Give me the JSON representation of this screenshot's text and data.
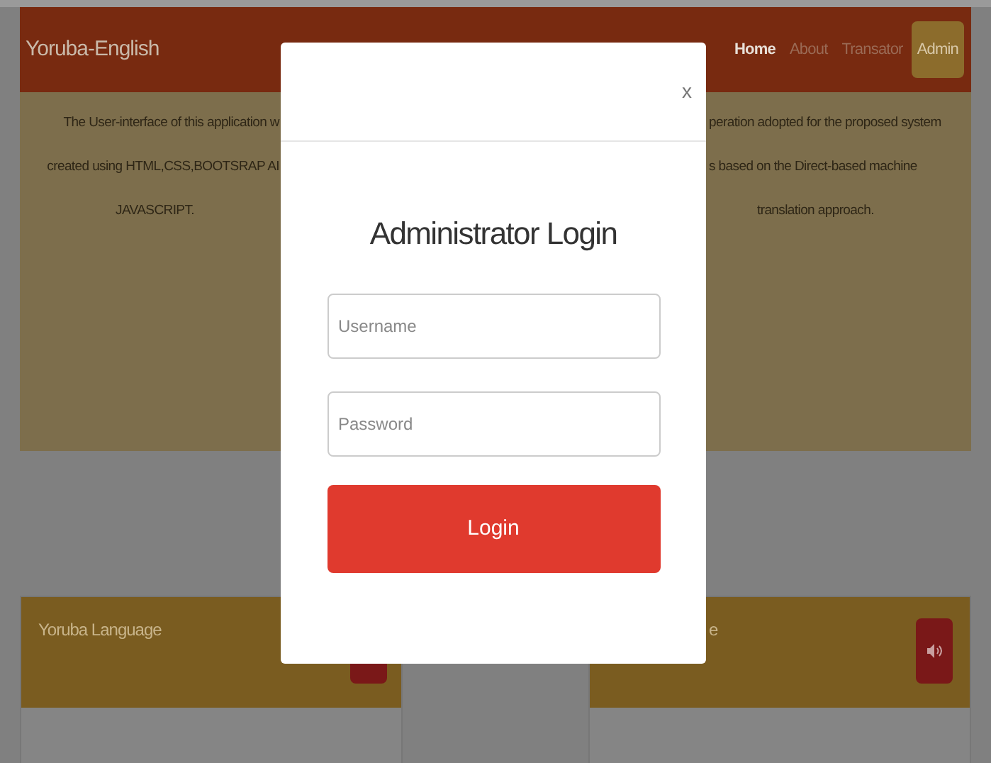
{
  "navbar": {
    "brand": "Yoruba-English",
    "links": [
      {
        "label": "Home",
        "selected": false,
        "current": true
      },
      {
        "label": "About",
        "selected": false,
        "current": false
      },
      {
        "label": "Transator",
        "selected": false,
        "current": false
      },
      {
        "label": "Admin",
        "selected": true,
        "current": false
      }
    ]
  },
  "intro": {
    "left_lines": [
      "The User-interface of this application w",
      "created using HTML,CSS,BOOTSRAP AI",
      "JAVASCRIPT."
    ],
    "right_lines": [
      "peration adopted for the proposed system",
      "s based on the Direct-based machine",
      "translation approach."
    ]
  },
  "cards": [
    {
      "title": "Yoruba Language"
    },
    {
      "title": "e"
    }
  ],
  "modal": {
    "close": "x",
    "title": "Administrator Login",
    "fields": [
      {
        "placeholder": "Username"
      },
      {
        "placeholder": "Password"
      }
    ],
    "button": "Login"
  }
}
